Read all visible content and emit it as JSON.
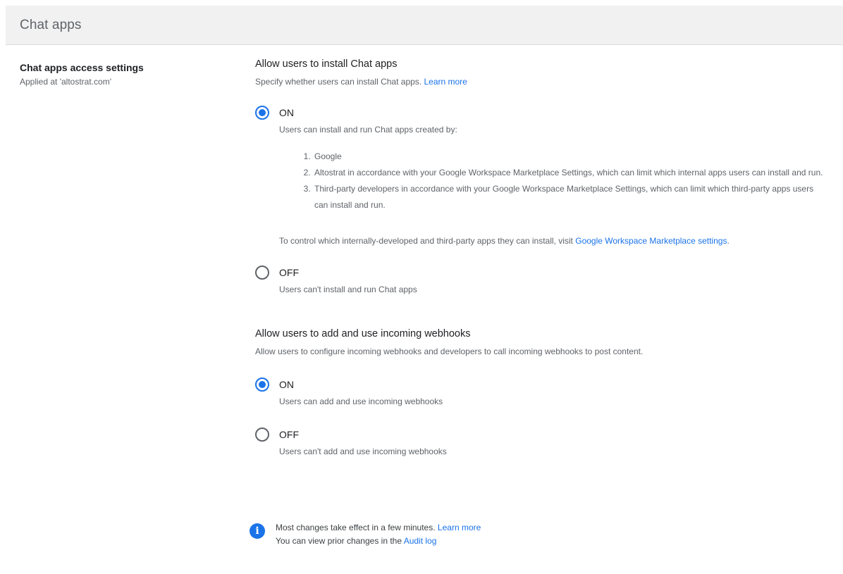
{
  "header": {
    "title": "Chat apps"
  },
  "left": {
    "title": "Chat apps access settings",
    "subtitle": "Applied at 'altostrat.com'"
  },
  "install": {
    "title": "Allow users to install Chat apps",
    "description": "Specify whether users can install Chat apps.",
    "learn_more": "Learn more",
    "on_label": "ON",
    "on_desc": "Users can install and run Chat apps created by:",
    "list": [
      "Google",
      "Altostrat in accordance with your Google Workspace Marketplace Settings, which can limit which internal apps users can install and run.",
      "Third-party developers in accordance with your Google Workspace Marketplace Settings, which can limit which third-party apps users can install and run."
    ],
    "control_text": "To control which internally-developed and third-party apps they can install, visit",
    "control_link": "Google Workspace Marketplace settings",
    "control_end": ".",
    "off_label": "OFF",
    "off_desc": "Users can't install and run Chat apps",
    "selected": "ON"
  },
  "webhooks": {
    "title": "Allow users to add and use incoming webhooks",
    "description": "Allow users to configure incoming webhooks and developers to call incoming webhooks to post content.",
    "on_label": "ON",
    "on_desc": "Users can add and use incoming webhooks",
    "off_label": "OFF",
    "off_desc": "Users can't add and use incoming webhooks",
    "selected": "ON"
  },
  "info": {
    "icon": "info-icon",
    "icon_glyph": "i",
    "line1": "Most changes take effect in a few minutes.",
    "line1_link": "Learn more",
    "line2": "You can view prior changes in the",
    "line2_link": "Audit log"
  },
  "colors": {
    "accent": "#1a73e8",
    "header_bg": "#f1f1f1"
  }
}
